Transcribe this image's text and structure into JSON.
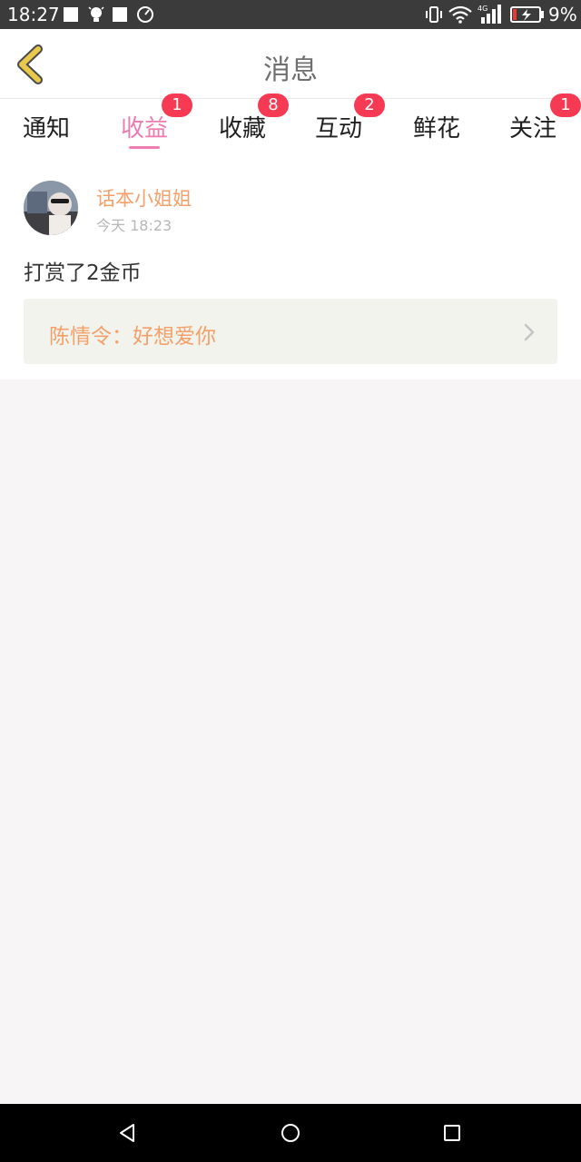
{
  "status_bar": {
    "time": "18:27",
    "battery_percent": "9%",
    "network": "4G"
  },
  "header": {
    "title": "消息"
  },
  "tabs": [
    {
      "label": "通知",
      "badge": "",
      "active": false
    },
    {
      "label": "收益",
      "badge": "1",
      "active": true
    },
    {
      "label": "收藏",
      "badge": "8",
      "active": false
    },
    {
      "label": "互动",
      "badge": "2",
      "active": false
    },
    {
      "label": "鲜花",
      "badge": "",
      "active": false
    },
    {
      "label": "关注",
      "badge": "1",
      "active": false
    }
  ],
  "message_card": {
    "username": "话本小姐姐",
    "timestamp": "今天 18:23",
    "text": "打赏了2金币",
    "quote": "陈情令：好想爱你"
  },
  "colors": {
    "accent_pink": "#ef7bb0",
    "badge_red": "#f73a54",
    "username_orange": "#f3a06a",
    "back_arrow_yellow": "#e8c94a"
  }
}
